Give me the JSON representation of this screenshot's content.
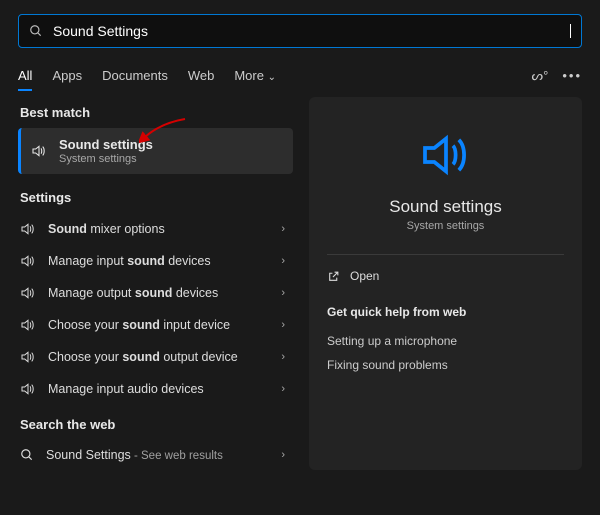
{
  "search": {
    "value": "Sound Settings"
  },
  "tabs": {
    "all": "All",
    "apps": "Apps",
    "documents": "Documents",
    "web": "Web",
    "more": "More"
  },
  "best_match_hdr": "Best match",
  "best_match": {
    "title": "Sound settings",
    "sub": "System settings"
  },
  "settings_hdr": "Settings",
  "settings_items": [
    {
      "pre": "",
      "bold": "Sound",
      "post": " mixer options"
    },
    {
      "pre": "Manage input ",
      "bold": "sound",
      "post": " devices"
    },
    {
      "pre": "Manage output ",
      "bold": "sound",
      "post": " devices"
    },
    {
      "pre": "Choose your ",
      "bold": "sound",
      "post": " input device"
    },
    {
      "pre": "Choose your ",
      "bold": "sound",
      "post": " output device"
    },
    {
      "pre": "Manage input audio devices",
      "bold": "",
      "post": ""
    }
  ],
  "web_hdr": "Search the web",
  "web_item": {
    "label": "Sound Settings",
    "suffix": " - See web results"
  },
  "detail": {
    "title": "Sound settings",
    "sub": "System settings",
    "open": "Open"
  },
  "quick_hdr": "Get quick help from web",
  "quick_links": [
    "Setting up a microphone",
    "Fixing sound problems"
  ]
}
